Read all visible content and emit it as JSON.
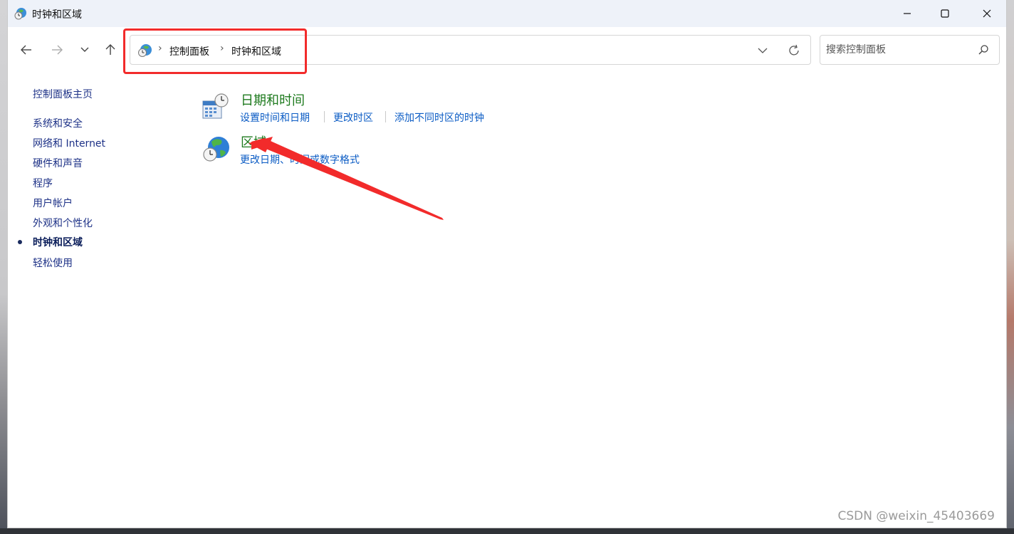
{
  "window": {
    "title": "时钟和区域",
    "minimize_label": "Minimize",
    "maximize_label": "Maximize",
    "close_label": "Close"
  },
  "nav": {
    "back_icon": "arrow-left-icon",
    "forward_icon": "arrow-right-icon",
    "recent_icon": "chevron-down-icon",
    "up_icon": "arrow-up-icon"
  },
  "address": {
    "breadcrumbs": [
      "控制面板",
      "时钟和区域"
    ],
    "separator": "›"
  },
  "search": {
    "placeholder": "搜索控制面板"
  },
  "sidebar": {
    "items": [
      {
        "label": "控制面板主页",
        "active": false
      },
      {
        "label": "系统和安全",
        "active": false
      },
      {
        "label": "网络和 Internet",
        "active": false
      },
      {
        "label": "硬件和声音",
        "active": false
      },
      {
        "label": "程序",
        "active": false
      },
      {
        "label": "用户帐户",
        "active": false
      },
      {
        "label": "外观和个性化",
        "active": false
      },
      {
        "label": "时钟和区域",
        "active": true
      },
      {
        "label": "轻松使用",
        "active": false
      }
    ]
  },
  "main": {
    "categories": [
      {
        "title": "日期和时间",
        "icon": "calendar-clock-icon",
        "links": [
          "设置时间和日期",
          "更改时区",
          "添加不同时区的时钟"
        ]
      },
      {
        "title": "区域",
        "icon": "globe-clock-icon",
        "links": [
          "更改日期、时间或数字格式"
        ]
      }
    ]
  },
  "colors": {
    "highlight_box": "#f22b2b",
    "category_title": "#1e7a1e",
    "link": "#0a5bc4",
    "sidebar_link": "#1e3287"
  },
  "watermark": "CSDN @weixin_45403669"
}
